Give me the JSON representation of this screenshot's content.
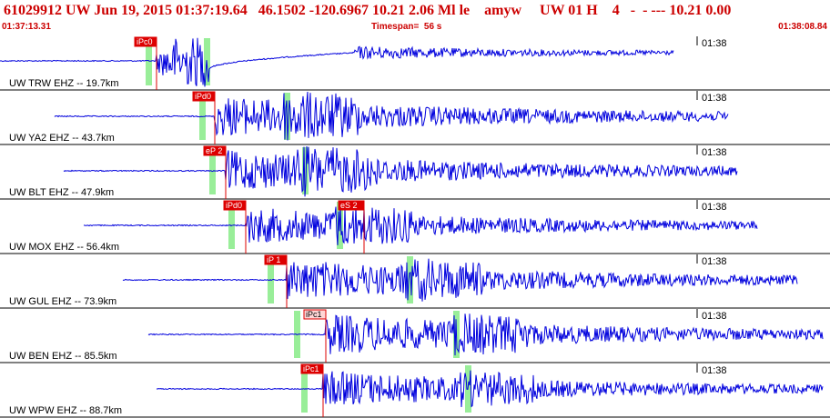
{
  "header": {
    "title": "61029912 UW Jun 19, 2015 01:37:19.64   46.1502 -120.6967 10.21 2.06 Ml le    amyw     UW 01 H    4   -  - --- 10.21 0.00",
    "start_time": "01:37:13.31",
    "timespan": "Timespan=  56 s",
    "end_time": "01:38:08.84"
  },
  "colors": {
    "title": "#cc0000",
    "trace": "#0000dd",
    "pick_box": "#dd0000",
    "pick_box_light": "#ffd6d6",
    "pick_line": "#dd0000",
    "green_marker": "#99ee99",
    "tick_line": "#000000"
  },
  "traces": [
    {
      "label": "UW TRW EHZ -- 19.7km",
      "tick": "01:38",
      "pick": "iPc0",
      "pick_style": "solid"
    },
    {
      "label": "UW YA2 EHZ -- 43.7km",
      "tick": "01:38",
      "pick": "iPd0",
      "pick_style": "solid"
    },
    {
      "label": "UW BLT EHZ -- 47.9km",
      "tick": "01:38",
      "pick": "eP 2",
      "pick_style": "solid"
    },
    {
      "label": "UW MOX EHZ -- 56.4km",
      "tick": "01:38",
      "pick": "iPd0",
      "pick_style": "solid",
      "pick2": "eS 2"
    },
    {
      "label": "UW GUL EHZ -- 73.9km",
      "tick": "01:38",
      "pick": "iP 1",
      "pick_style": "solid"
    },
    {
      "label": "UW BEN EHZ -- 85.5km",
      "tick": "01:38",
      "pick": "iPc1",
      "pick_style": "light"
    },
    {
      "label": "UW WPW EHZ -- 88.7km",
      "tick": "01:38",
      "pick": "iPc1",
      "pick_style": "solid"
    }
  ]
}
